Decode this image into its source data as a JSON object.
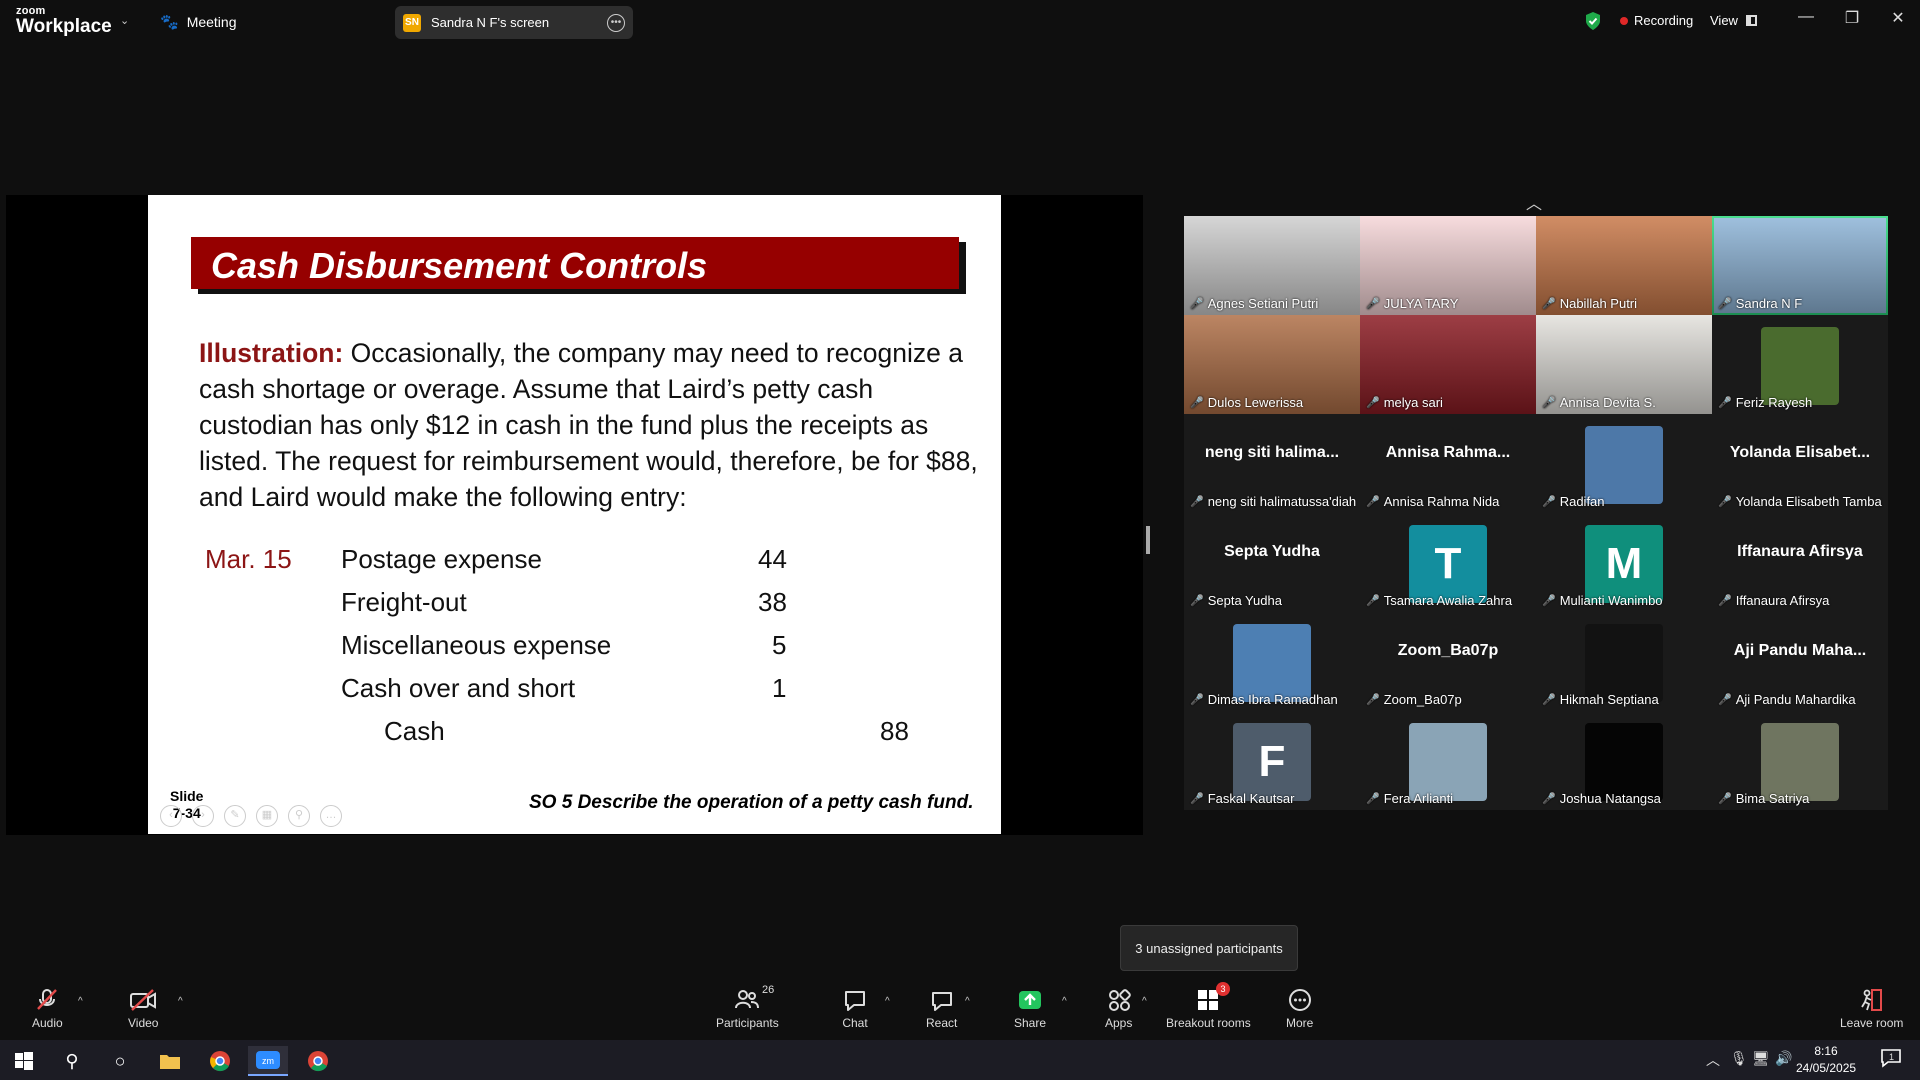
{
  "titlebar": {
    "brand_top": "zoom",
    "brand_bottom": "Workplace",
    "meeting_label": "Meeting",
    "screen_badge": "SN",
    "screen_label": "Sandra N F's screen",
    "recording_label": "Recording",
    "view_label": "View"
  },
  "slide": {
    "title": "Cash Disbursement Controls",
    "lead": "Illustration:",
    "body": "Occasionally, the company may need to recognize a cash shortage or overage.  Assume that Laird’s petty cash custodian has only $12 in cash in the fund plus the receipts as listed. The request for reimbursement would, therefore, be for $88, and Laird would make the following entry:",
    "entry_date": "Mar. 15",
    "entries": [
      {
        "account": "Postage expense",
        "debit": "44"
      },
      {
        "account": "Freight-out",
        "debit": "38"
      },
      {
        "account": "Miscellaneous expense",
        "debit": "5"
      },
      {
        "account": "Cash over and short",
        "debit": "1"
      }
    ],
    "credit_account": "Cash",
    "credit_amount": "88",
    "slide_label": "Slide",
    "slide_number": "7-34",
    "footer": "SO 5  Describe the operation of a petty cash fund."
  },
  "participants": [
    {
      "name": "Agnes Setiani Putri",
      "kind": "photo",
      "color": "#cfcfcf"
    },
    {
      "name": "JULYA TARY",
      "kind": "photo",
      "color": "#f6d6d8"
    },
    {
      "name": "Nabillah Putri",
      "kind": "photo",
      "color": "#c9794a"
    },
    {
      "name": "Sandra N F",
      "kind": "photo",
      "color": "#8fb6d9",
      "active": true
    },
    {
      "name": "Dulos Lewerissa",
      "kind": "photo",
      "color": "#b07048"
    },
    {
      "name": "melya sari",
      "kind": "photo",
      "color": "#8c1c24"
    },
    {
      "name": "Annisa Devita S.",
      "kind": "photo",
      "color": "#e3e1dc"
    },
    {
      "name": "Feriz Rayesh",
      "kind": "small",
      "color": "#4a6b2e"
    },
    {
      "name": "neng siti halimatussa'diah",
      "kind": "text",
      "display": "neng siti halima..."
    },
    {
      "name": "Annisa Rahma Nida",
      "kind": "text",
      "display": "Annisa Rahma..."
    },
    {
      "name": "Radifan",
      "kind": "small",
      "color": "#4d78a8"
    },
    {
      "name": "Yolanda Elisabeth Tamba",
      "kind": "text",
      "display": "Yolanda Elisabet..."
    },
    {
      "name": "Septa Yudha",
      "kind": "text",
      "display": "Septa Yudha"
    },
    {
      "name": "Tsamara Awalia Zahra",
      "kind": "avatar",
      "letter": "T",
      "color": "#138e9e"
    },
    {
      "name": "Mulianti Wanimbo",
      "kind": "avatar",
      "letter": "M",
      "color": "#0f8f7c"
    },
    {
      "name": "Iffanaura Afirsya",
      "kind": "text",
      "display": "Iffanaura Afirsya"
    },
    {
      "name": "Dimas Ibra Ramadhan",
      "kind": "small",
      "color": "#4d7fb3"
    },
    {
      "name": "Zoom_Ba07p",
      "kind": "text",
      "display": "Zoom_Ba07p"
    },
    {
      "name": "Hikmah Septiana",
      "kind": "small",
      "color": "#121212"
    },
    {
      "name": "Aji Pandu Mahardika",
      "kind": "text",
      "display": "Aji Pandu Maha..."
    },
    {
      "name": "Faskal Kautsar",
      "kind": "avatar",
      "letter": "F",
      "color": "#4e5c6b"
    },
    {
      "name": "Fera Arlianti",
      "kind": "small",
      "color": "#8aa4b6"
    },
    {
      "name": "Joshua Natangsa",
      "kind": "small",
      "color": "#050505"
    },
    {
      "name": "Bima Satriya",
      "kind": "small",
      "color": "#6f7560"
    }
  ],
  "tooltip": "3 unassigned participants",
  "toolbar": {
    "audio": "Audio",
    "video": "Video",
    "participants": "Participants",
    "participant_count": "26",
    "chat": "Chat",
    "react": "React",
    "share": "Share",
    "apps": "Apps",
    "breakout": "Breakout rooms",
    "breakout_badge": "3",
    "more": "More",
    "leave": "Leave room"
  },
  "taskbar": {
    "time": "8:16",
    "date": "24/05/2025",
    "notifications": "1"
  },
  "colors": {
    "accent_green": "#2bd97c",
    "title_red": "#960000",
    "share_green": "#23c55e"
  }
}
